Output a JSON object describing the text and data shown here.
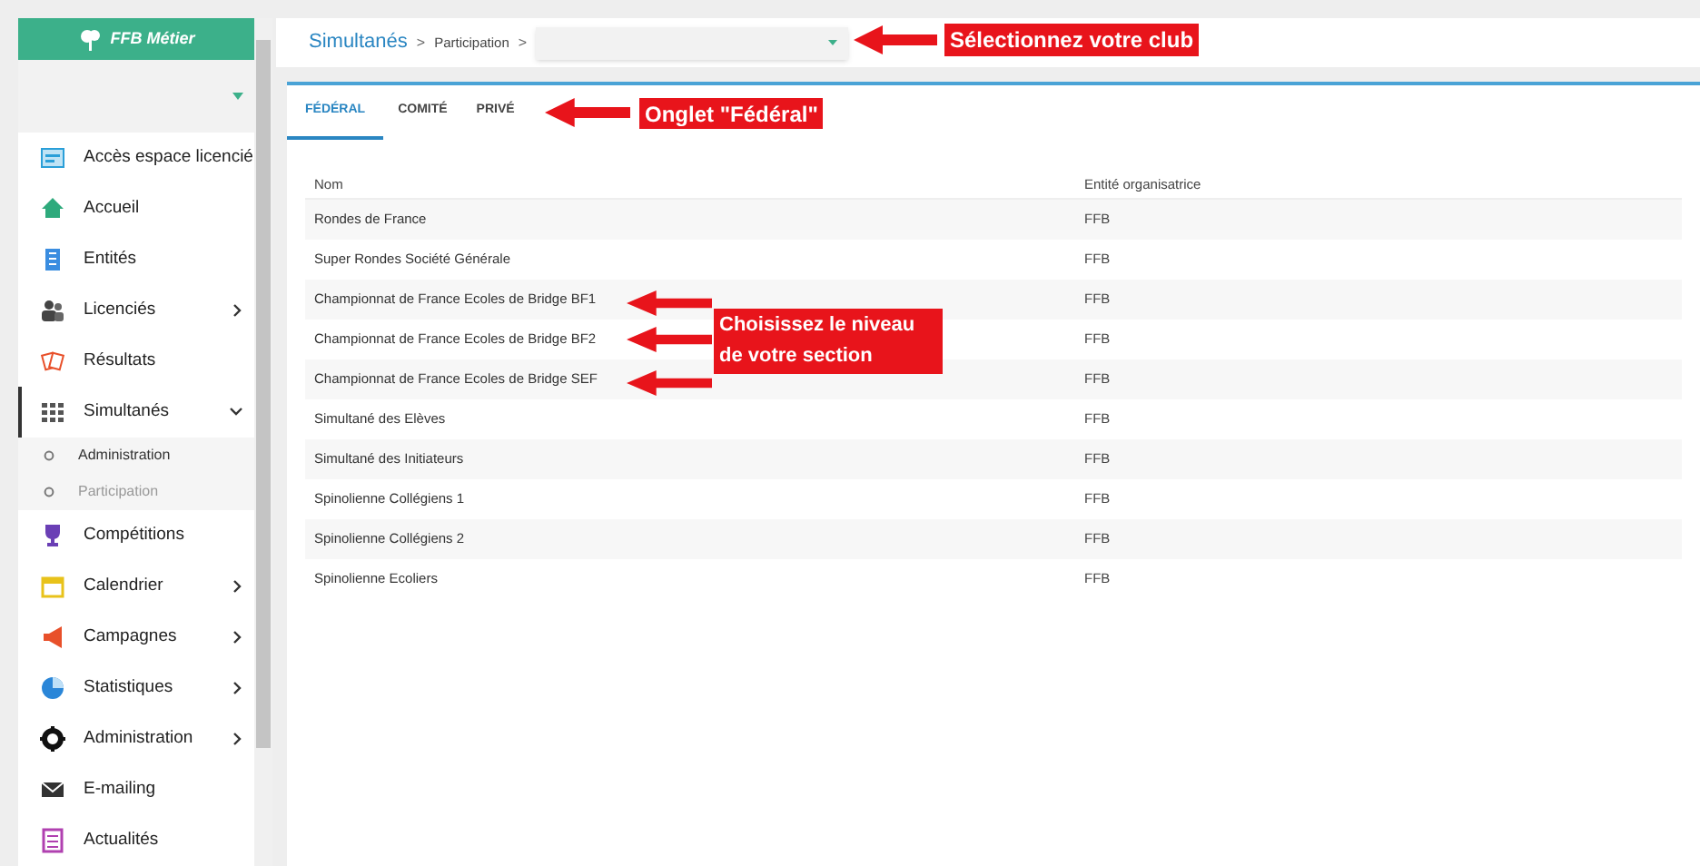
{
  "sidebar": {
    "logo_text": "FFB Métier",
    "items": [
      {
        "label": "Accès espace licencié",
        "selected": false
      },
      {
        "label": "Accueil",
        "selected": false
      },
      {
        "label": "Entités",
        "selected": false
      },
      {
        "label": "Licenciés",
        "expanded": false,
        "selected": false
      },
      {
        "label": "Résultats",
        "selected": false
      },
      {
        "label": "Simultanés",
        "expanded": true,
        "selected": true,
        "children": [
          {
            "label": "Administration",
            "selected": false
          },
          {
            "label": "Participation",
            "selected": true
          }
        ]
      },
      {
        "label": "Compétitions",
        "selected": false
      },
      {
        "label": "Calendrier",
        "expanded": false,
        "selected": false
      },
      {
        "label": "Campagnes",
        "expanded": false,
        "selected": false
      },
      {
        "label": "Statistiques",
        "expanded": false,
        "selected": false
      },
      {
        "label": "Administration",
        "expanded": false,
        "selected": false
      },
      {
        "label": "E-mailing",
        "selected": false
      },
      {
        "label": "Actualités",
        "selected": false
      }
    ]
  },
  "breadcrumb": [
    "Simultanés",
    "Participation"
  ],
  "breadcrumb_separators": [
    ">",
    ">"
  ],
  "tabs": [
    {
      "label": "FÉDÉRAL",
      "selected": true
    },
    {
      "label": "COMITÉ",
      "selected": false
    },
    {
      "label": "PRIVÉ",
      "selected": false
    }
  ],
  "table": {
    "columns": [
      "Nom",
      "Entité organisatrice"
    ],
    "rows": [
      [
        "Rondes de France",
        "FFB"
      ],
      [
        "Super Rondes Société Générale",
        "FFB"
      ],
      [
        "Championnat de France Ecoles de Bridge BF1",
        "FFB"
      ],
      [
        "Championnat de France Ecoles de Bridge BF2",
        "FFB"
      ],
      [
        "Championnat de France Ecoles de Bridge SEF",
        "FFB"
      ],
      [
        "Simultané des Elèves",
        "FFB"
      ],
      [
        "Simultané des Initiateurs",
        "FFB"
      ],
      [
        "Spinolienne Collégiens 1",
        "FFB"
      ],
      [
        "Spinolienne Collégiens 2",
        "FFB"
      ],
      [
        "Spinolienne Ecoliers",
        "FFB"
      ]
    ]
  },
  "annotations": [
    {
      "text": "Sélectionnez votre club"
    },
    {
      "text": "Onglet \"Fédéral\""
    },
    {
      "text": "Choisissez le niveau de votre section"
    }
  ]
}
